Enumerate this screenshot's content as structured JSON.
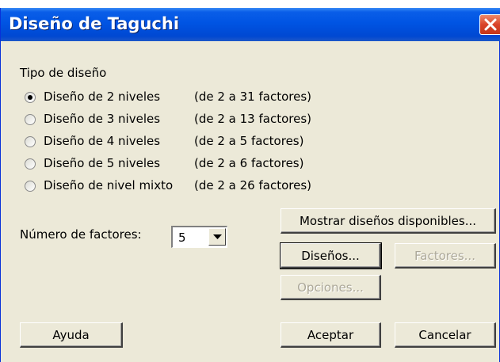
{
  "window": {
    "title": "Diseño de Taguchi",
    "close_icon": "close-icon"
  },
  "design_type": {
    "heading": "Tipo de diseño",
    "options": [
      {
        "label": "Diseño de 2 niveles",
        "range": "(de 2 a 31 factores)",
        "checked": true
      },
      {
        "label": "Diseño de 3 niveles",
        "range": "(de 2 a 13 factores)",
        "checked": false
      },
      {
        "label": "Diseño de 4 niveles",
        "range": "(de 2 a 5 factores)",
        "checked": false
      },
      {
        "label": "Diseño de 5 niveles",
        "range": "(de 2 a 6 factores)",
        "checked": false
      },
      {
        "label": "Diseño de nivel mixto",
        "range": "(de 2 a 26 factores)",
        "checked": false
      }
    ]
  },
  "factors": {
    "label": "Número de factores:",
    "value": "5"
  },
  "buttons": {
    "show_designs": "Mostrar diseños disponibles...",
    "designs": "Diseños...",
    "factors": "Factores...",
    "options": "Opciones...",
    "help": "Ayuda",
    "ok": "Aceptar",
    "cancel": "Cancelar"
  }
}
